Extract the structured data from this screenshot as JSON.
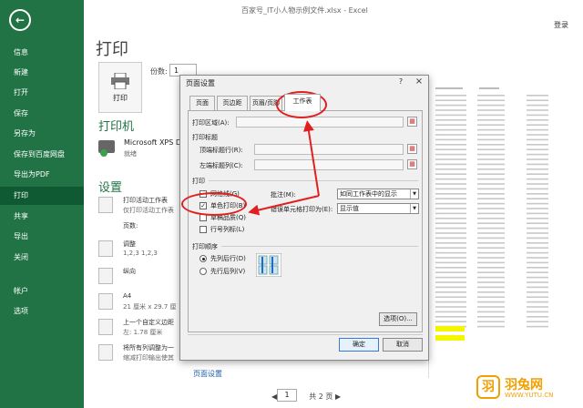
{
  "window": {
    "title": "百家号_IT小人物示例文件.xlsx - Excel",
    "login": "登录"
  },
  "sidebar": {
    "back_icon": "back-arrow-icon",
    "items": [
      {
        "label": "信息"
      },
      {
        "label": "新建"
      },
      {
        "label": "打开"
      },
      {
        "label": "保存"
      },
      {
        "label": "另存为"
      },
      {
        "label": "保存到百度网盘"
      },
      {
        "label": "导出为PDF"
      },
      {
        "label": "打印",
        "active": true
      },
      {
        "label": "共享"
      },
      {
        "label": "导出"
      },
      {
        "label": "关闭"
      },
      {
        "label": "帐户"
      },
      {
        "label": "选项"
      }
    ]
  },
  "main": {
    "title": "打印",
    "print_button": "打印",
    "copies_label": "份数:",
    "copies_value": "1",
    "printer_section": "打印机",
    "printer_name": "Microsoft XPS Doc",
    "printer_status": "就绪",
    "settings_section": "设置",
    "settings": [
      {
        "t1": "打印活动工作表",
        "t2": "仅打印活动工作表"
      },
      {
        "t1": "页数:",
        "t2": ""
      },
      {
        "t1": "调整",
        "t2": "1,2,3    1,2,3"
      },
      {
        "t1": "纵向",
        "t2": ""
      },
      {
        "t1": "A4",
        "t2": "21 厘米 x 29.7 厘"
      },
      {
        "t1": "上一个自定义边距",
        "t2": "左: 1.78 厘米"
      },
      {
        "t1": "将所有列调整为一",
        "t2": "缩减打印输出使其"
      }
    ],
    "page_setup_link": "页面设置",
    "pager": {
      "current": "1",
      "total_text": "共 2 页"
    }
  },
  "dialog": {
    "title": "页面设置",
    "help": "?",
    "close": "×",
    "tabs": [
      {
        "label": "页面"
      },
      {
        "label": "页边距"
      },
      {
        "label": "页眉/页脚"
      },
      {
        "label": "工作表",
        "active": true
      }
    ],
    "print_area_label": "打印区域(A):",
    "print_titles_label": "打印标题",
    "top_rows_label": "顶端标题行(R):",
    "left_cols_label": "左端标题列(C):",
    "print_label": "打印",
    "gridlines_label": "网格线(G)",
    "mono_label": "单色打印(B)",
    "draft_label": "草稿品质(Q)",
    "rowcol_label": "行号列标(L)",
    "comments_label": "批注(M):",
    "comments_value": "如同工作表中的显示",
    "errors_label": "错误单元格打印为(E):",
    "errors_value": "显示值",
    "order_label": "打印顺序",
    "down_then_over": "先列后行(D)",
    "over_then_down": "先行后列(V)",
    "options_button": "选项(O)...",
    "ok_button": "确定",
    "cancel_button": "取消"
  },
  "watermark": {
    "logo": "羽",
    "name": "羽兔网",
    "url": "WWW.YUTU.CN"
  },
  "colors": {
    "accent": "#217346",
    "highlight": "#e02020"
  }
}
